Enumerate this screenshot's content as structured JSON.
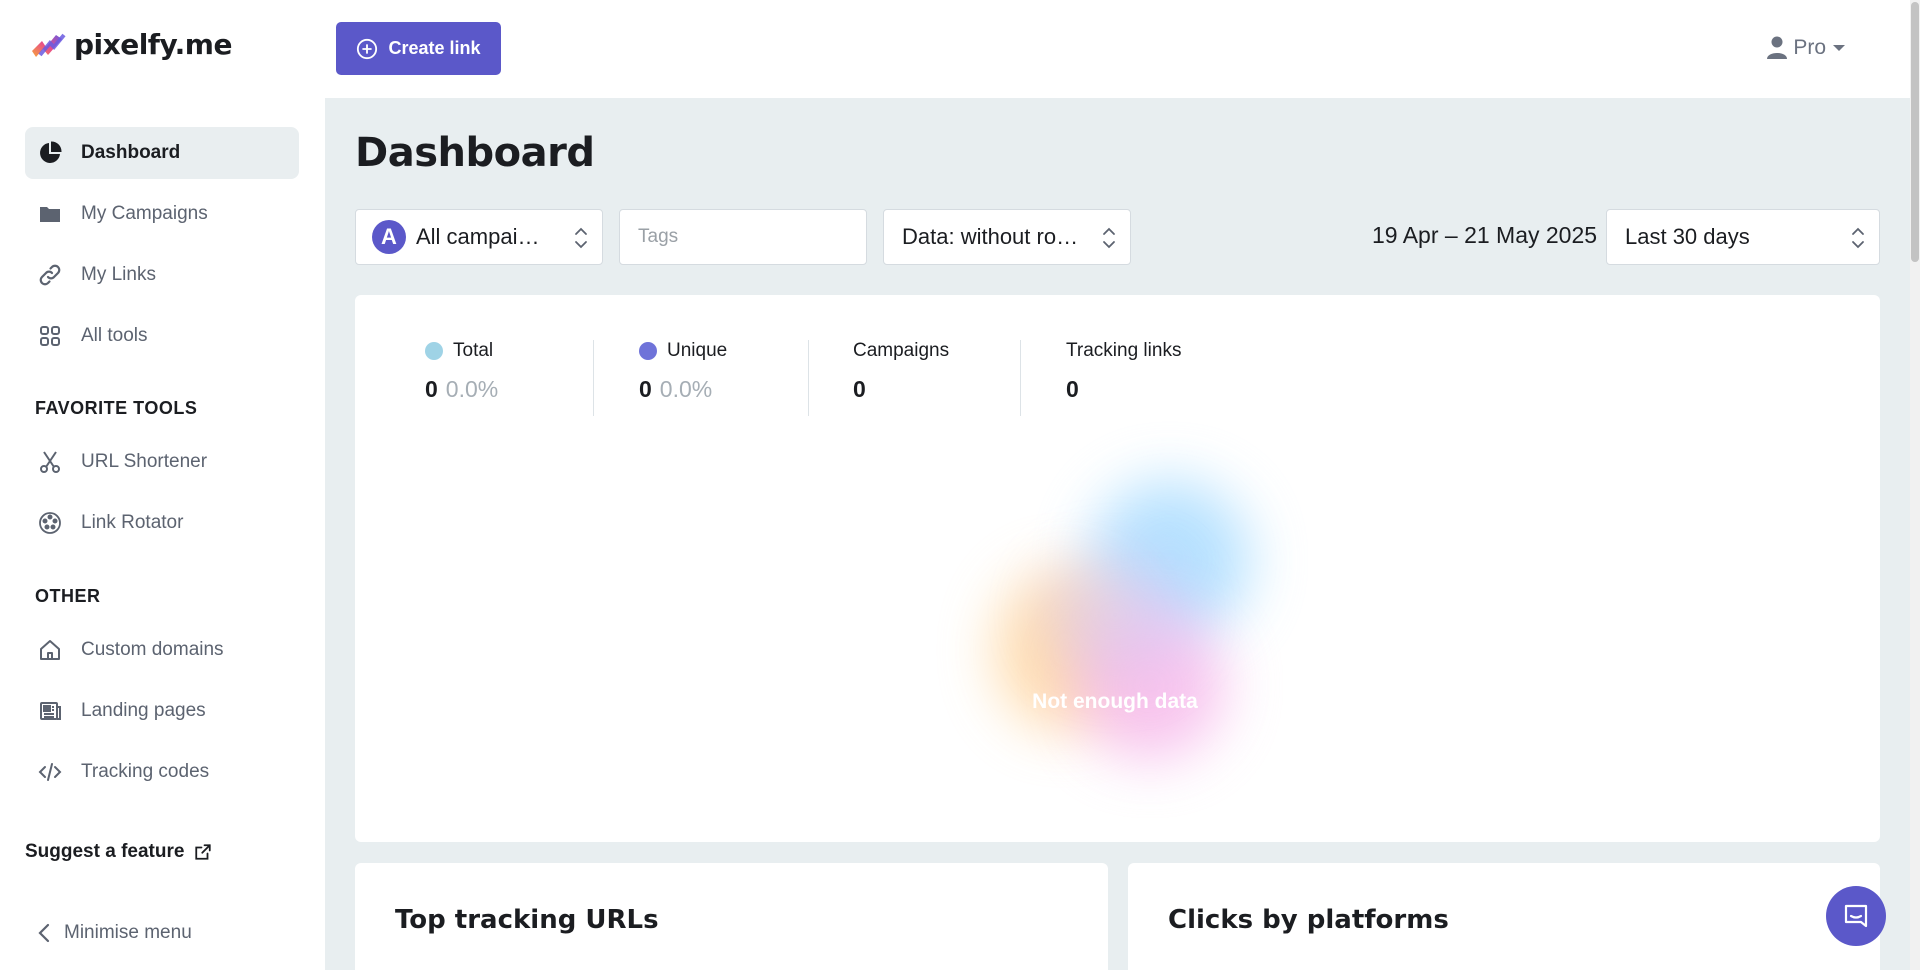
{
  "app": {
    "logo_text": "pixelfy.me"
  },
  "sidebar": {
    "items": [
      {
        "label": "Dashboard",
        "icon": "pie-chart-icon",
        "active": true
      },
      {
        "label": "My Campaigns",
        "icon": "folder-icon"
      },
      {
        "label": "My Links",
        "icon": "link-icon"
      },
      {
        "label": "All tools",
        "icon": "grid-icon"
      }
    ],
    "favorite_title": "FAVORITE TOOLS",
    "favorites": [
      {
        "label": "URL Shortener",
        "icon": "scissors-icon"
      },
      {
        "label": "Link Rotator",
        "icon": "rotator-icon"
      }
    ],
    "other_title": "OTHER",
    "other": [
      {
        "label": "Custom domains",
        "icon": "home-icon"
      },
      {
        "label": "Landing pages",
        "icon": "newspaper-icon"
      },
      {
        "label": "Tracking codes",
        "icon": "code-icon"
      }
    ],
    "suggest_label": "Suggest a feature",
    "minimise_label": "Minimise menu"
  },
  "topbar": {
    "create_label": "Create link",
    "plan_label": "Pro"
  },
  "main": {
    "title": "Dashboard",
    "filters": {
      "campaign_avatar": "A",
      "campaign_value": "All campai…",
      "tags_placeholder": "Tags",
      "data_value": "Data: without ro…",
      "date_range": "19 Apr – 21 May 2025",
      "period_value": "Last 30 days"
    },
    "stats": [
      {
        "label": "Total",
        "value": "0",
        "pct": "0.0%",
        "color": "#9fd3e6"
      },
      {
        "label": "Unique",
        "value": "0",
        "pct": "0.0%",
        "color": "#6f73d9"
      },
      {
        "label": "Campaigns",
        "value": "0"
      },
      {
        "label": "Tracking links",
        "value": "0"
      }
    ],
    "empty_message": "Not enough data",
    "cards": {
      "top_urls_title": "Top tracking URLs",
      "platforms_title": "Clicks by platforms"
    }
  },
  "colors": {
    "accent": "#5b58c9",
    "background": "#e8eef0"
  }
}
